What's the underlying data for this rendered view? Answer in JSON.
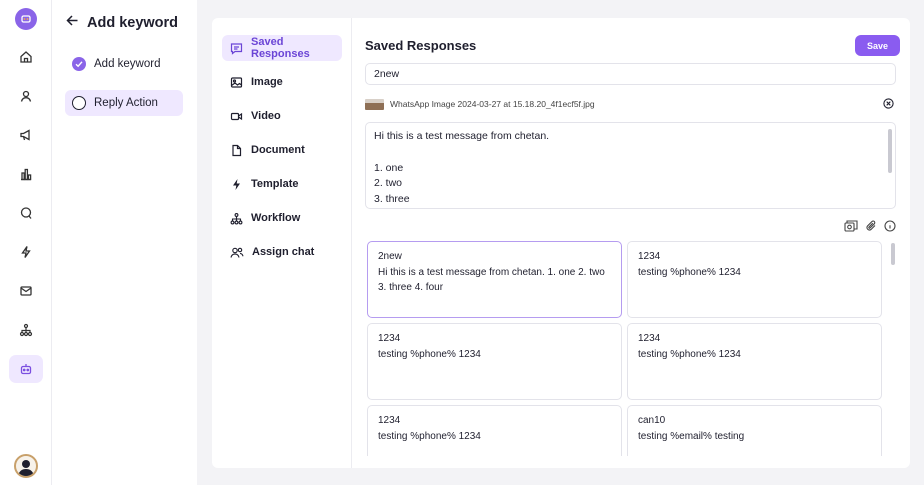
{
  "rail": {
    "items": [
      {
        "icon": "home-icon"
      },
      {
        "icon": "user-icon"
      },
      {
        "icon": "megaphone-icon"
      },
      {
        "icon": "bar-chart-icon"
      },
      {
        "icon": "chat-icon"
      },
      {
        "icon": "lightning-icon"
      },
      {
        "icon": "mail-icon"
      },
      {
        "icon": "hierarchy-icon"
      },
      {
        "icon": "bot-icon",
        "active": true
      }
    ]
  },
  "steps": {
    "title": "Add keyword",
    "items": [
      {
        "label": "Add keyword",
        "state": "done"
      },
      {
        "label": "Reply Action",
        "state": "current"
      }
    ]
  },
  "types": {
    "items": [
      {
        "label": "Saved Responses",
        "icon": "saved-responses-icon",
        "active": true
      },
      {
        "label": "Image",
        "icon": "image-icon"
      },
      {
        "label": "Video",
        "icon": "video-icon"
      },
      {
        "label": "Document",
        "icon": "document-icon"
      },
      {
        "label": "Template",
        "icon": "template-icon"
      },
      {
        "label": "Workflow",
        "icon": "workflow-icon"
      },
      {
        "label": "Assign chat",
        "icon": "assign-chat-icon"
      }
    ]
  },
  "panel": {
    "title": "Saved Responses",
    "save_label": "Save",
    "name_value": "2new",
    "attachment_name": "WhatsApp Image 2024-03-27 at 15.18.20_4f1ecf5f.jpg",
    "message_lines": [
      "Hi this is a test message from chetan.",
      "",
      "1. one",
      "2. two",
      "3. three"
    ]
  },
  "responses": [
    {
      "title": "2new",
      "body": "Hi this is a test message from chetan. 1. one 2. two 3. three 4. four",
      "selected": true
    },
    {
      "title": "1234",
      "body": "testing %phone% 1234"
    },
    {
      "title": "1234",
      "body": "testing %phone% 1234"
    },
    {
      "title": "1234",
      "body": "testing %phone% 1234"
    },
    {
      "title": "1234",
      "body": "testing %phone% 1234"
    },
    {
      "title": "can10",
      "body": "testing %email% testing"
    }
  ],
  "colors": {
    "accent": "#8a5cf0",
    "accent_light": "#efe8ff"
  }
}
